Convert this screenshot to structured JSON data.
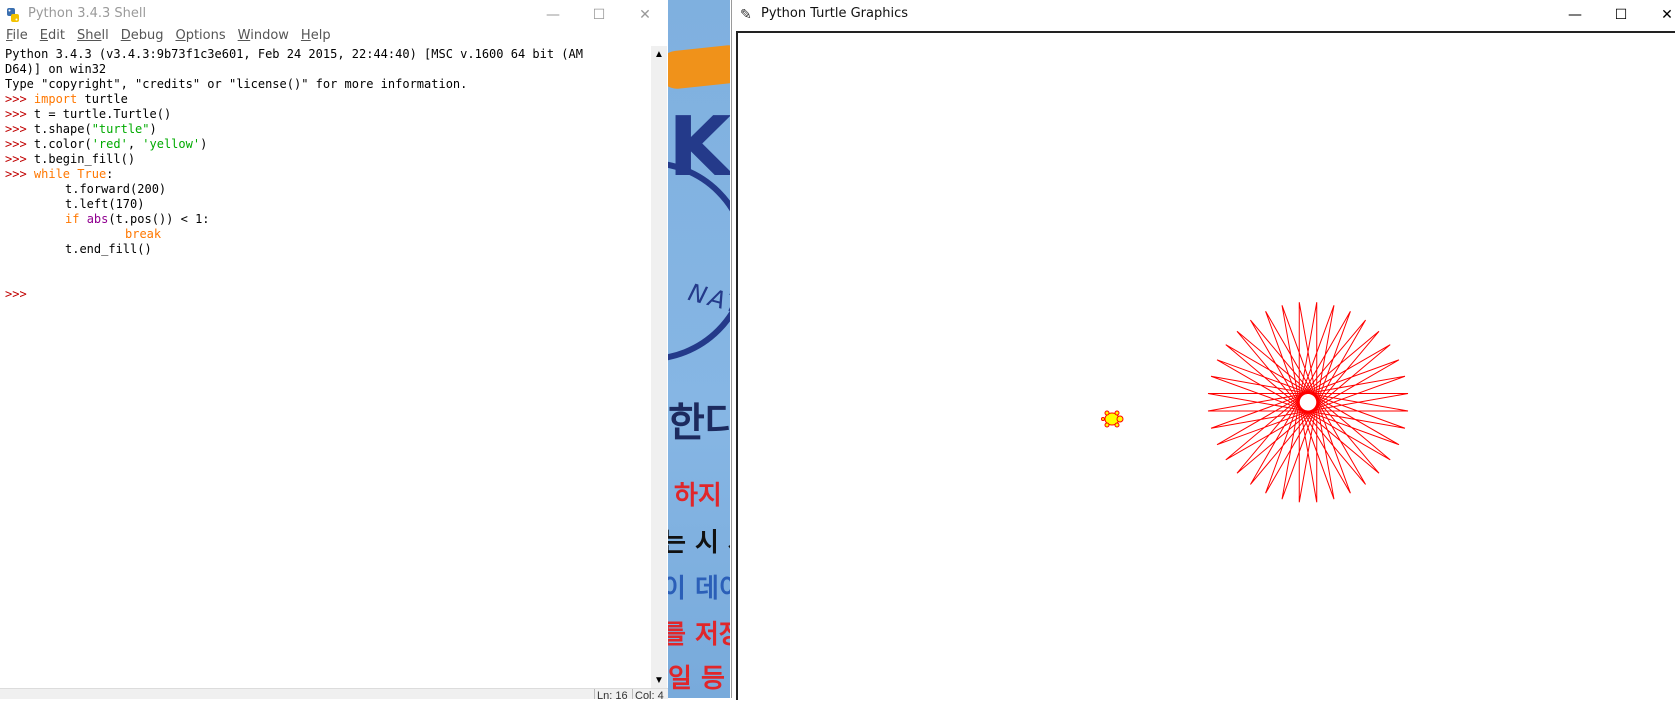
{
  "shell": {
    "title": "Python 3.4.3 Shell",
    "controls": {
      "minimize": "—",
      "maximize": "☐",
      "close": "✕"
    },
    "menu": [
      {
        "first": "F",
        "rest": "ile"
      },
      {
        "first": "E",
        "rest": "dit"
      },
      {
        "first": "She",
        "rest": "ll"
      },
      {
        "first": "D",
        "rest": "ebug"
      },
      {
        "first": "O",
        "rest": "ptions"
      },
      {
        "first": "W",
        "rest": "indow"
      },
      {
        "first": "H",
        "rest": "elp"
      }
    ],
    "banner1": "Python 3.4.3 (v3.4.3:9b73f1c3e601, Feb 24 2015, 22:44:40) [MSC v.1600 64 bit (AM",
    "banner2": "D64)] on win32",
    "banner3": "Type \"copyright\", \"credits\" or \"license()\" for more information.",
    "prompt": ">>> ",
    "code": {
      "l1_kw": "import",
      "l1_rest": " turtle",
      "l2": "t = turtle.Turtle()",
      "l3_a": "t.shape(",
      "l3_s": "\"turtle\"",
      "l3_b": ")",
      "l4_a": "t.color(",
      "l4_s1": "'red'",
      "l4_c": ", ",
      "l4_s2": "'yellow'",
      "l4_b": ")",
      "l5": "t.begin_fill()",
      "l6_kw": "while",
      "l6_sp": " ",
      "l6_kw2": "True",
      "l6_rest": ":",
      "l7": "t.forward(200)",
      "l8": "t.left(170)",
      "l9_kw": "if",
      "l9_sp": " ",
      "l9_bi": "abs",
      "l9_rest": "(t.pos()) < 1:",
      "l10_kw": "break",
      "l11": "t.end_fill()",
      "last_prompt": ">>>"
    },
    "status": {
      "ln": "Ln: 16",
      "col": "Col: 4"
    }
  },
  "backdrop": {
    "k_glyph": "K",
    "nat": "NAT",
    "lines": [
      "한다",
      "하지",
      "는 시 사",
      "이 데이",
      "를 저장",
      "일 등"
    ]
  },
  "turtle_window": {
    "title": "Python Turtle Graphics",
    "controls": {
      "minimize": "—",
      "maximize": "☐",
      "close": "✕"
    },
    "drawing": {
      "pen_color": "#ff0000",
      "fill_color": "#ffff00",
      "shape": "turtle",
      "forward": 200,
      "left_angle": 170
    }
  }
}
